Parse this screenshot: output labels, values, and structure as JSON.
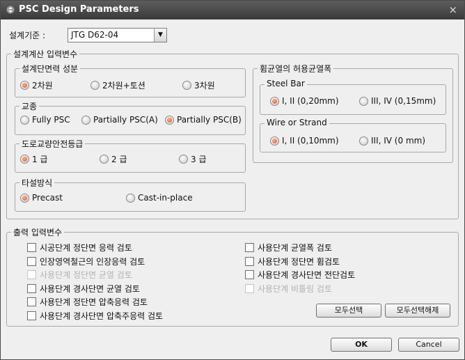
{
  "window": {
    "title": "PSC Design Parameters",
    "close": "×"
  },
  "standard": {
    "label": "설계기준 :",
    "value": "JTG D62-04",
    "arrow": "▼"
  },
  "calc_inputs": {
    "legend": "설계계산 입력변수",
    "section": {
      "legend": "설계단면력 성분",
      "options": [
        "2차원",
        "2차원+토션",
        "3차원"
      ],
      "selected": 0
    },
    "bridge_type": {
      "legend": "교종",
      "options": [
        "Fully PSC",
        "Partially PSC(A)",
        "Partially PSC(B)"
      ],
      "selected": 2
    },
    "safety_grade": {
      "legend": "도로교량안전등급",
      "options": [
        "1 급",
        "2 급",
        "3 급"
      ],
      "selected": 0
    },
    "casting": {
      "legend": "타설방식",
      "options": [
        "Precast",
        "Cast-in-place"
      ],
      "selected": 0
    }
  },
  "crack": {
    "legend": "휨균열의 허용균열폭",
    "steel_bar": {
      "legend": "Steel Bar",
      "options": [
        "I, II (0,20mm)",
        "III, IV (0,15mm)"
      ],
      "selected": 0
    },
    "wire": {
      "legend": "Wire or Strand",
      "options": [
        "I, II (0,10mm)",
        "III, IV (0 mm)"
      ],
      "selected": 0
    }
  },
  "output": {
    "legend": "출력 입력변수",
    "left": [
      {
        "label": "시공단계 정단면 응력 검토",
        "enabled": true
      },
      {
        "label": "인장영역철근의 인장응력 검토",
        "enabled": true
      },
      {
        "label": "사용단계 정단면 균열 검토",
        "enabled": false
      },
      {
        "label": "사용단계 경사단면 균열 검토",
        "enabled": true
      },
      {
        "label": "사용단계 정단면 압축응력 검토",
        "enabled": true
      },
      {
        "label": "사용단계 경사단면 압축주응력 검토",
        "enabled": true
      }
    ],
    "right": [
      {
        "label": "사용단계 균열폭 검토",
        "enabled": true
      },
      {
        "label": "사용단계 정단면 휨검토",
        "enabled": true
      },
      {
        "label": "사용단계 경사단면 전단검토",
        "enabled": true
      },
      {
        "label": "사용단계 비틀림 검토",
        "enabled": false
      }
    ],
    "select_all": "모두선택",
    "deselect_all": "모두선택해제"
  },
  "buttons": {
    "ok": "OK",
    "cancel": "Cancel"
  }
}
